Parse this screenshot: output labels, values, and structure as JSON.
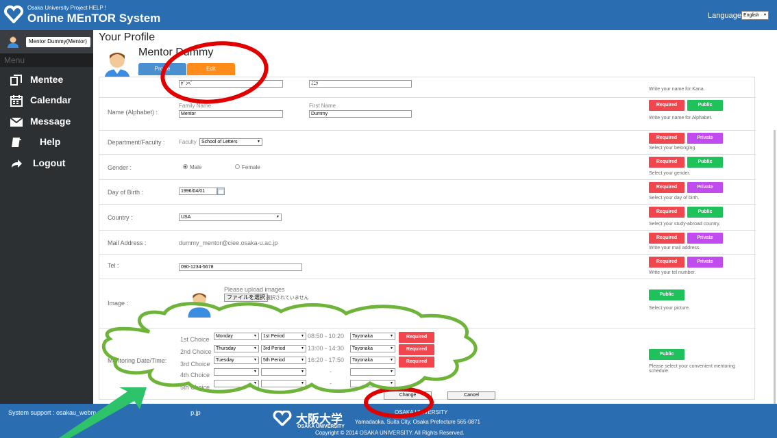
{
  "header": {
    "logo_small": "Osaka University Project HELP !",
    "logo_big": "Online MEnTOR System",
    "language_label": "Language",
    "language_value": "English"
  },
  "sidebar": {
    "user": "Mentor Dummy(Mentor)",
    "menu_label": "Menu",
    "items": [
      {
        "label": "Mentee",
        "icon": "mentee-icon"
      },
      {
        "label": "Calendar",
        "icon": "calendar-icon"
      },
      {
        "label": "Message",
        "icon": "envelope-icon"
      },
      {
        "label": "Help",
        "icon": "book-icon"
      },
      {
        "label": "Logout",
        "icon": "logout-arrow-icon"
      }
    ]
  },
  "profile": {
    "page_title": "Your Profile",
    "name": "Mentor Dummy",
    "tab_profile": "Profile",
    "tab_edit": "Edit"
  },
  "form": {
    "kana": {
      "family_value": "ﾎﾞﾝﾍﾞ",
      "first_value": "ﾐﾆﾂ",
      "hint": "Write your name for Kana."
    },
    "alphabet": {
      "label": "Name (Alphabet) :",
      "family_label": "Family Name",
      "first_label": "First Name",
      "family_value": "Mentor",
      "first_value": "Dummy",
      "hint": "Write your name for Alphabet."
    },
    "department": {
      "label": "Department/Faculty :",
      "prefix": "Faculty",
      "value": "School of Letters",
      "hint": "Select your belonging."
    },
    "gender": {
      "label": "Gender :",
      "male": "Male",
      "female": "Female",
      "hint": "Select your gender."
    },
    "birth": {
      "label": "Day of Birth :",
      "value": "1996/04/01",
      "hint": "Select your day of birth."
    },
    "country": {
      "label": "Country :",
      "value": "USA",
      "hint": "Select your study-abroad country."
    },
    "mail": {
      "label": "Mail Address :",
      "value": "dummy_mentor@ciee.osaka-u.ac.jp",
      "hint": "Write your mail address."
    },
    "tel": {
      "label": "Tel :",
      "value": "090-1234-5678",
      "hint": "Write your tel number."
    },
    "image": {
      "label": "Image :",
      "upload_text": "Please upload images",
      "file_button": "ファイルを選択",
      "file_status": "選択されていません",
      "hint": "Select your picture."
    },
    "schedule": {
      "label": "Mentoring Date/Time:",
      "hint": "Please select your convenient mentoring schedule.",
      "choices": [
        {
          "name": "1st Choice",
          "day": "Monday",
          "period": "1st Period",
          "time": "08:50 - 10:20",
          "campus": "Toyonaka"
        },
        {
          "name": "2nd Choice",
          "day": "Thursday",
          "period": "3rd Period",
          "time": "13:00 - 14:30",
          "campus": "Toyonaka"
        },
        {
          "name": "3rd Choice",
          "day": "Tuesday",
          "period": "5th Period",
          "time": "16:20 - 17:50",
          "campus": "Toyonaka"
        },
        {
          "name": "4th Choice",
          "day": "",
          "period": "",
          "time": "-",
          "campus": ""
        },
        {
          "name": "5th Choice",
          "day": "",
          "period": "",
          "time": "-",
          "campus": ""
        }
      ]
    },
    "badges": {
      "required": "Required",
      "public": "Public",
      "private": "Private"
    },
    "change_button": "Change",
    "cancel_button": "Cancel"
  },
  "footer": {
    "support": "System support : osakau_webm",
    "support_tail": "p.jp",
    "univ_jp": "大阪大学",
    "univ_en": "OSAKA UNIVERSITY",
    "univ_right": "OSAKA UNIVERSITY",
    "address": "Yamadaoka, Suita City, Osaka Prefecture 565-0871",
    "copyright": "Copyright © 2014 OSAKA UNIVERSITY. All Rights Reserved."
  },
  "colors": {
    "header_blue": "#2a6db0",
    "required_red": "#f0474e",
    "public_green": "#1fc15a",
    "private_purple": "#c04cf0",
    "edit_orange": "#ff8c1a",
    "annotation_red": "#e00000",
    "annotation_green": "#6fb43a"
  }
}
